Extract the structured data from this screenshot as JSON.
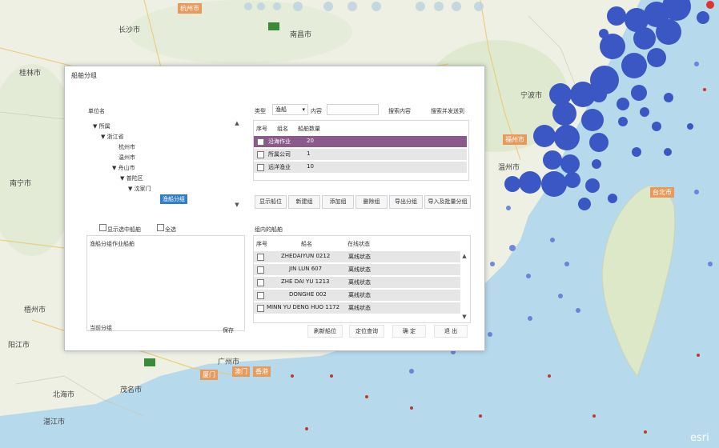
{
  "map": {
    "labels": {
      "l1": "杭州市",
      "l2": "宁波市",
      "l3": "福州市",
      "l4": "台北市",
      "l5": "厦门",
      "l6": "澳门",
      "l7": "香港",
      "l8": "湛江市",
      "l9": "南宁市",
      "l10": "广州市",
      "l11": "长沙市",
      "l12": "南昌市",
      "l13": "温州市",
      "l14": "桂林市",
      "l15": "梧州市",
      "l16": "阳江市",
      "l17": "北海市",
      "l18": "茂名市"
    },
    "watermark": "esri",
    "colors": {
      "land": "#eef0e4",
      "sea": "#b7d9ec",
      "taiwan": "#dde8c8",
      "bubble": "#3b57c4",
      "small_dot": "#c0392b"
    }
  },
  "dialog": {
    "title": "船舶分组",
    "left_section_label": "单位名",
    "tree": [
      {
        "label": "▼  所属"
      },
      {
        "label": "▼  浙江省"
      },
      {
        "label": "杭州市"
      },
      {
        "label": "温州市"
      },
      {
        "label": "▼  舟山市"
      },
      {
        "label": "▼  普陀区"
      },
      {
        "label": "▼  沈家门"
      },
      {
        "label": "渔船分组"
      }
    ],
    "search": {
      "field_label": "类型",
      "select_value": "渔船",
      "keyword_label": "内容",
      "search_button": "搜索内容",
      "reset_button": "搜索并发送到"
    },
    "groups_table": {
      "headers": [
        "序号",
        "组名",
        "船舶数量"
      ],
      "rows": [
        {
          "name": "沿海作业",
          "count": "20"
        },
        {
          "name": "所属公司",
          "count": "1"
        },
        {
          "name": "远洋渔业",
          "count": "10"
        }
      ]
    },
    "tabs": [
      "显示船位",
      "新建组",
      "添加组",
      "删除组",
      "导出分组",
      "导入及批量分组"
    ],
    "filter": {
      "checkbox1": "显示选中船舶",
      "checkbox2": "全选"
    },
    "group_name_input": "渔船分组作业船舶",
    "bottom_left_label": "当前分组",
    "bottom_left_button": "保存",
    "ships_section_label": "组内的船舶",
    "ships_table": {
      "headers": [
        "序号",
        "船名",
        "在线状态"
      ],
      "rows": [
        {
          "name": "ZHEDAIYUN 0212",
          "status": "离线状态"
        },
        {
          "name": "JIN LUN 607",
          "status": "离线状态"
        },
        {
          "name": "ZHE DAI YU 1213",
          "status": "离线状态"
        },
        {
          "name": "DONGHE 002",
          "status": "离线状态"
        },
        {
          "name": "MINN YU DENG HUO 1172",
          "status": "离线状态"
        }
      ]
    },
    "footer_buttons": [
      "刷新船位",
      "定位查询",
      "确 定",
      "退 出"
    ]
  }
}
